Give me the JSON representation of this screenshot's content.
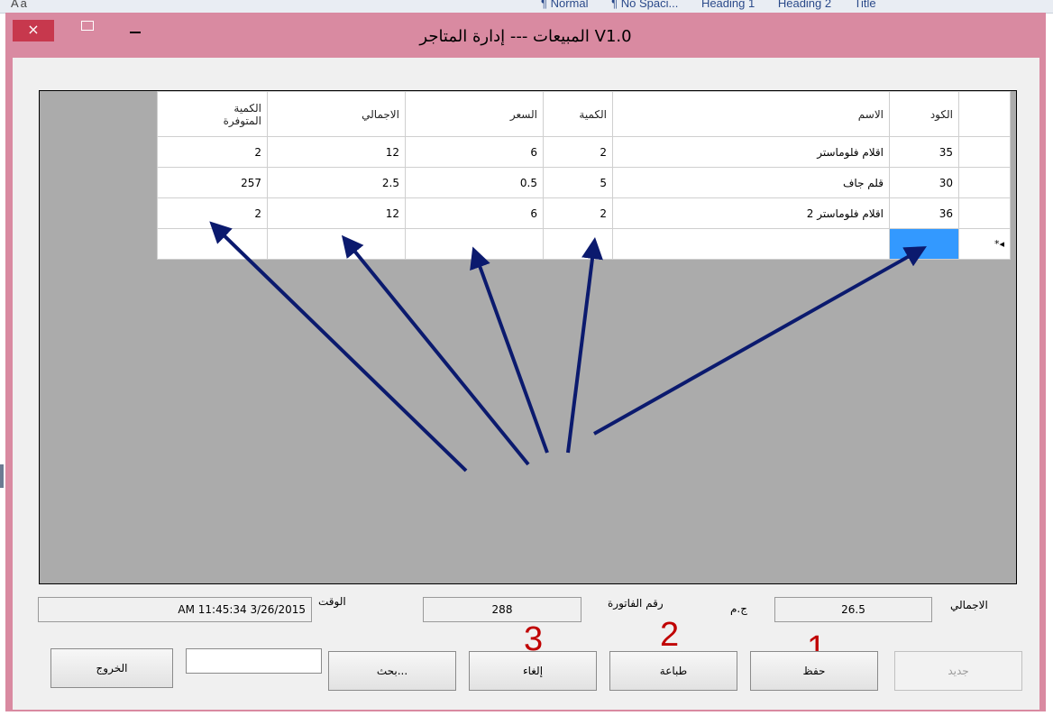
{
  "window": {
    "title": "المبيعات --- إدارة المتاجر V1.0",
    "close_glyph": "×"
  },
  "background": {
    "ribbon_left": "Aa",
    "ribbon_styles": [
      "¶ Normal",
      "¶ No Spaci...",
      "Heading 1",
      "Heading 2",
      "Title"
    ]
  },
  "grid": {
    "headers": {
      "code": "الكود",
      "name": "الاسم",
      "qty": "الكمية",
      "price": "السعر",
      "total": "الاجمالي",
      "available_line1": "الكمية",
      "available_line2": "المتوفرة"
    },
    "rows": [
      {
        "code": "35",
        "name": "اقلام فلوماستر",
        "qty": "2",
        "price": "6",
        "total": "12",
        "available": "2"
      },
      {
        "code": "30",
        "name": "قلم جاف",
        "qty": "5",
        "price": "0.5",
        "total": "2.5",
        "available": "257"
      },
      {
        "code": "36",
        "name": "اقلام فلوماستر 2",
        "qty": "2",
        "price": "6",
        "total": "12",
        "available": "2"
      }
    ],
    "new_row_marker": "*◂"
  },
  "footer": {
    "total_label": "الاجمالي",
    "total_value": "26.5",
    "currency": "ج.م",
    "invoice_label": "رقم الفاتورة",
    "invoice_value": "288",
    "time_label": "الوقت",
    "time_value": "AM 11:45:34 3/26/2015"
  },
  "buttons": {
    "new": "جديد",
    "save": "حفظ",
    "print": "طباعة",
    "cancel": "إلغاء",
    "search": "بحث...",
    "exit": "الخروج"
  },
  "annotations": {
    "n1": "1",
    "n2": "2",
    "n3": "3"
  },
  "colors": {
    "window_frame": "#d98aa1",
    "close_button": "#c7384d",
    "selected_cell": "#3399ff",
    "grid_background": "#ababab",
    "arrow": "#0b1a6e",
    "annotation_numbers": "#c00000"
  }
}
